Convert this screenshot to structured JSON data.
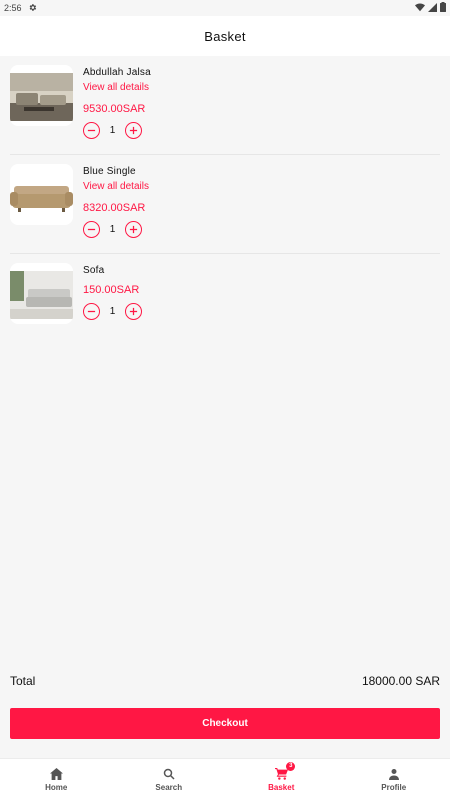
{
  "status_bar": {
    "time": "2:56"
  },
  "header": {
    "title": "Basket"
  },
  "items": [
    {
      "name": "Abdullah Jalsa",
      "details_label": "View all details",
      "price": "9530.00SAR",
      "quantity": "1"
    },
    {
      "name": "Blue Single",
      "details_label": "View all details",
      "price": "8320.00SAR",
      "quantity": "1"
    },
    {
      "name": "Sofa",
      "price": "150.00SAR",
      "quantity": "1"
    }
  ],
  "summary": {
    "total_label": "Total",
    "total_value": "18000.00 SAR"
  },
  "checkout": {
    "label": "Checkout"
  },
  "nav": {
    "items": [
      {
        "label": "Home",
        "icon": "home-icon"
      },
      {
        "label": "Search",
        "icon": "search-icon"
      },
      {
        "label": "Basket",
        "icon": "cart-icon",
        "badge": "3",
        "active": true
      },
      {
        "label": "Profile",
        "icon": "person-icon"
      }
    ]
  },
  "colors": {
    "accent": "#ff1744",
    "background": "#f6f6f6"
  }
}
